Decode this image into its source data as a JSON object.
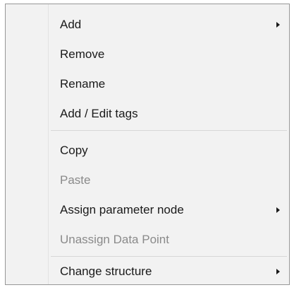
{
  "context_menu": {
    "items": [
      {
        "label": "Add",
        "enabled": true,
        "submenu": true
      },
      {
        "label": "Remove",
        "enabled": true,
        "submenu": false
      },
      {
        "label": "Rename",
        "enabled": true,
        "submenu": false
      },
      {
        "label": "Add / Edit tags",
        "enabled": true,
        "submenu": false
      },
      {
        "label": "Copy",
        "enabled": true,
        "submenu": false
      },
      {
        "label": "Paste",
        "enabled": false,
        "submenu": false
      },
      {
        "label": "Assign parameter node",
        "enabled": true,
        "submenu": true
      },
      {
        "label": "Unassign Data Point",
        "enabled": false,
        "submenu": false
      },
      {
        "label": "Change structure",
        "enabled": true,
        "submenu": true
      }
    ]
  }
}
